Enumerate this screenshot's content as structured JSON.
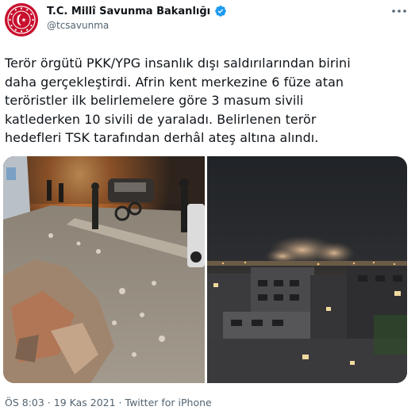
{
  "account": {
    "display_name": "T.C. Millî Savunma Bakanlığı",
    "handle": "@tcsavunma",
    "verified": true,
    "verified_color": "#1d9bf0",
    "avatar_color": "#c8102e"
  },
  "tweet": {
    "lines": [
      "Terör örgütü PKK/YPG insanlık dışı saldırılarından birini",
      "daha gerçekleştirdi. Afrin kent merkezine 6 füze atan",
      "teröristler ilk belirlemelere göre 3 masum sivili",
      "katlederken 10 sivili de yaraladı. Belirlenen terör",
      "hedefleri TSK tarafından derhâl ateş altına alındı."
    ]
  },
  "media": {
    "count": 2,
    "left_scene": "rubble-street-at-night",
    "right_scene": "night-city-skyline-smoke"
  },
  "meta": {
    "time": "ÖS 8:03",
    "separator": " · ",
    "date": "19 Kas 2021",
    "source": "Twitter for iPhone"
  },
  "icons": {
    "more": "more-options-icon",
    "verified": "verified-badge-icon"
  }
}
